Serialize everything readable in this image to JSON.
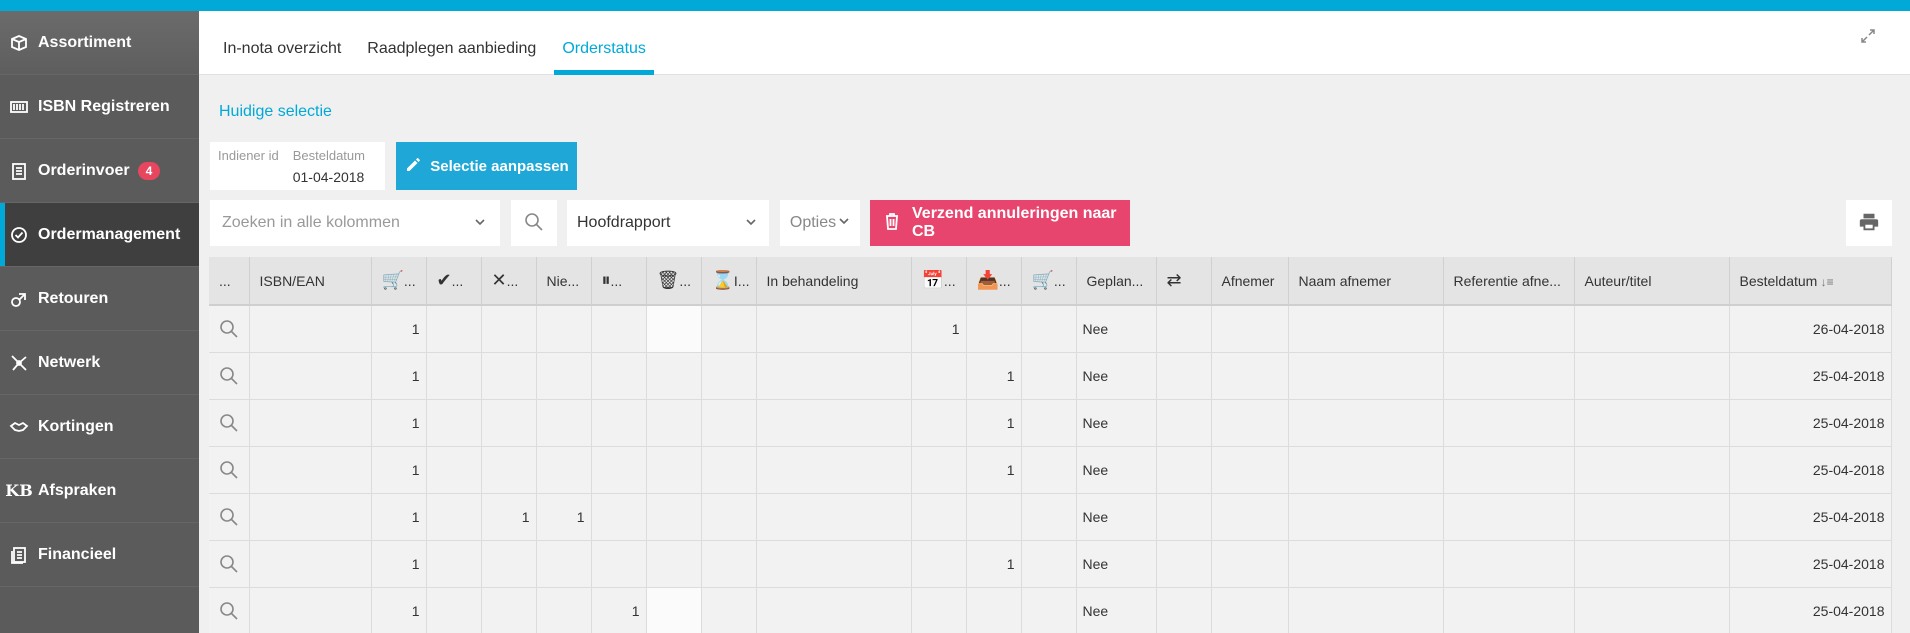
{
  "sidebar": {
    "items": [
      {
        "label": "Assortiment",
        "icon": "box-icon"
      },
      {
        "label": "ISBN Registreren",
        "icon": "barcode-icon"
      },
      {
        "label": "Orderinvoer",
        "icon": "clipboard-icon",
        "badge": "4"
      },
      {
        "label": "Ordermanagement",
        "icon": "check-circle-icon",
        "active": true
      },
      {
        "label": "Retouren",
        "icon": "return-icon"
      },
      {
        "label": "Netwerk",
        "icon": "network-icon"
      },
      {
        "label": "Kortingen",
        "icon": "handshake-icon"
      },
      {
        "label": "Afspraken",
        "icon": "kb-icon",
        "glyph": "KB"
      },
      {
        "label": "Financieel",
        "icon": "finance-icon"
      }
    ]
  },
  "tabs": [
    {
      "label": "In-nota overzicht"
    },
    {
      "label": "Raadplegen aanbieding"
    },
    {
      "label": "Orderstatus",
      "active": true
    }
  ],
  "selection": {
    "title": "Huidige selectie",
    "col1_label": "Indiener id",
    "col1_value": "",
    "col2_label": "Besteldatum",
    "col2_value": "01-04-2018",
    "edit_label": "Selectie aanpassen"
  },
  "toolbar": {
    "search_placeholder": "Zoeken in alle kolommen",
    "report": "Hoofdrapport",
    "options_label": "Opties",
    "cancel_label": "Verzend annuleringen naar CB"
  },
  "colors": {
    "accent": "#00a9d8",
    "danger": "#e8456e",
    "sidebar": "#5b5b5b"
  },
  "table": {
    "headers": [
      "...",
      "ISBN/EAN",
      "...",
      "...",
      "...",
      "Nie...",
      "...",
      "...",
      "I...",
      "In behandeling",
      "...",
      "...",
      "...",
      "Geplan...",
      "",
      "Afnemer",
      "Naam afnemer",
      "Referentie afne...",
      "Auteur/titel",
      "Besteldatum"
    ],
    "rows": [
      {
        "c": [
          "",
          "",
          "1",
          "",
          "",
          "",
          "",
          "",
          "",
          "",
          "1",
          "",
          "",
          "Nee",
          "",
          "",
          "",
          "",
          "",
          "26-04-2018"
        ]
      },
      {
        "c": [
          "",
          "",
          "1",
          "",
          "",
          "",
          "",
          "",
          "",
          "",
          "",
          "1",
          "",
          "Nee",
          "",
          "",
          "",
          "",
          "",
          "25-04-2018"
        ]
      },
      {
        "c": [
          "",
          "",
          "1",
          "",
          "",
          "",
          "",
          "",
          "",
          "",
          "",
          "1",
          "",
          "Nee",
          "",
          "",
          "",
          "",
          "",
          "25-04-2018"
        ]
      },
      {
        "c": [
          "",
          "",
          "1",
          "",
          "",
          "",
          "",
          "",
          "",
          "",
          "",
          "1",
          "",
          "Nee",
          "",
          "",
          "",
          "",
          "",
          "25-04-2018"
        ]
      },
      {
        "c": [
          "",
          "",
          "1",
          "",
          "1",
          "1",
          "",
          "",
          "",
          "",
          "",
          "",
          "",
          "Nee",
          "",
          "",
          "",
          "",
          "",
          "25-04-2018"
        ]
      },
      {
        "c": [
          "",
          "",
          "1",
          "",
          "",
          "",
          "",
          "",
          "",
          "",
          "",
          "1",
          "",
          "Nee",
          "",
          "",
          "",
          "",
          "",
          "25-04-2018"
        ]
      },
      {
        "c": [
          "",
          "",
          "1",
          "",
          "",
          "",
          "1",
          "",
          "",
          "",
          "",
          "",
          "",
          "Nee",
          "",
          "",
          "",
          "",
          "",
          "25-04-2018"
        ]
      }
    ]
  }
}
